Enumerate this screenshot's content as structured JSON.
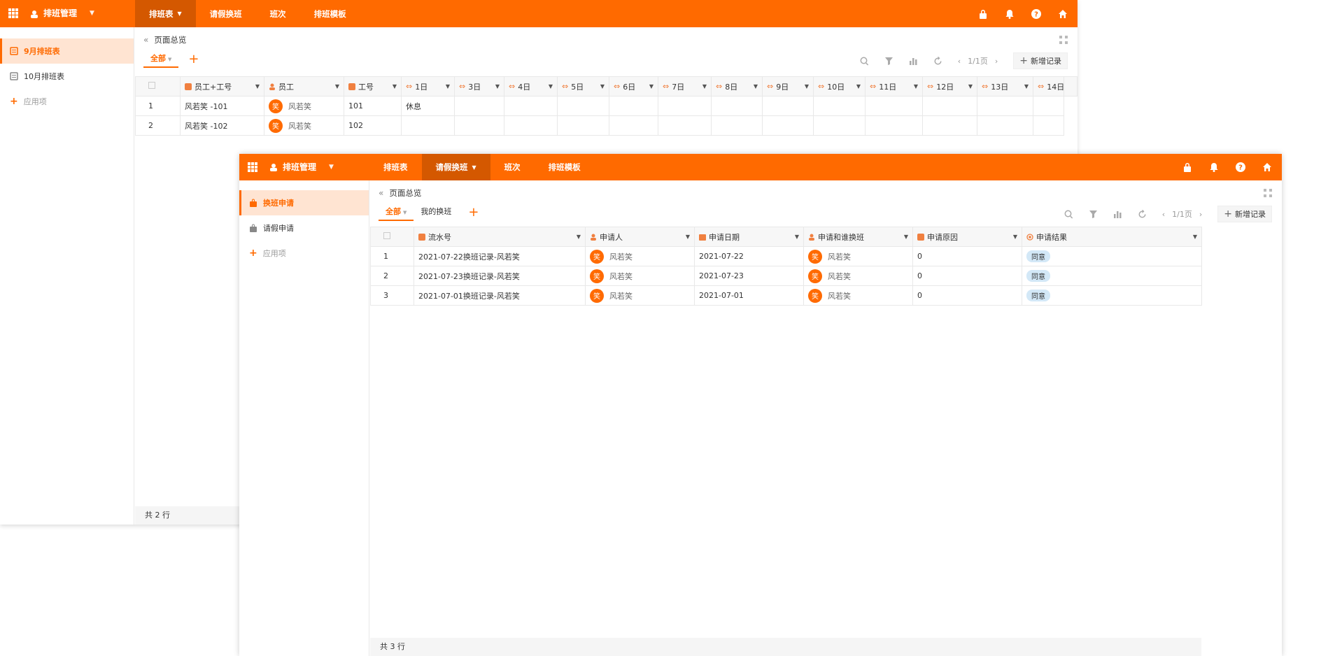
{
  "win1": {
    "app_title": "排班管理",
    "nav": [
      {
        "label": "排班表",
        "active": true,
        "has_caret": true
      },
      {
        "label": "请假换班",
        "active": false,
        "has_caret": false
      },
      {
        "label": "班次",
        "active": false,
        "has_caret": false
      },
      {
        "label": "排班模板",
        "active": false,
        "has_caret": false
      }
    ],
    "sidebar": [
      {
        "label": "9月排班表",
        "icon": "table-icon",
        "active": true
      },
      {
        "label": "10月排班表",
        "icon": "table-icon",
        "active": false
      },
      {
        "label": "应用项",
        "icon": "plus-icon",
        "active": false
      }
    ],
    "crumb": "页面总览",
    "view_tab": "全部",
    "pager": "1/1页",
    "add_label": "新增记录",
    "columns": [
      "员工+工号",
      "员工",
      "工号",
      "1日",
      "3日",
      "4日",
      "5日",
      "6日",
      "7日",
      "8日",
      "9日",
      "10日",
      "11日",
      "12日",
      "13日",
      "14日"
    ],
    "rows": [
      {
        "idx": "1",
        "emp_no": "风若笑 -101",
        "avatar": "笑",
        "name": "风若笑",
        "no": "101",
        "d1": "休息"
      },
      {
        "idx": "2",
        "emp_no": "风若笑 -102",
        "avatar": "笑",
        "name": "风若笑",
        "no": "102",
        "d1": ""
      }
    ],
    "footer": "共 2 行"
  },
  "win2": {
    "app_title": "排班管理",
    "nav": [
      {
        "label": "排班表",
        "active": false,
        "has_caret": false
      },
      {
        "label": "请假换班",
        "active": true,
        "has_caret": true
      },
      {
        "label": "班次",
        "active": false,
        "has_caret": false
      },
      {
        "label": "排班模板",
        "active": false,
        "has_caret": false
      }
    ],
    "sidebar": [
      {
        "label": "换班申请",
        "icon": "bag-icon",
        "active": true
      },
      {
        "label": "请假申请",
        "icon": "bag-icon",
        "active": false
      },
      {
        "label": "应用项",
        "icon": "plus-icon",
        "active": false
      }
    ],
    "crumb": "页面总览",
    "view_tabs": [
      "全部",
      "我的换班"
    ],
    "pager": "1/1页",
    "add_label": "新增记录",
    "columns": [
      "流水号",
      "申请人",
      "申请日期",
      "申请和谁换班",
      "申请原因",
      "申请结果"
    ],
    "rows": [
      {
        "idx": "1",
        "serial": "2021-07-22换班记录-风若笑",
        "avatar": "笑",
        "applicant": "风若笑",
        "date": "2021-07-22",
        "with": "风若笑",
        "reason": "0",
        "result": "同意"
      },
      {
        "idx": "2",
        "serial": "2021-07-23换班记录-风若笑",
        "avatar": "笑",
        "applicant": "风若笑",
        "date": "2021-07-23",
        "with": "风若笑",
        "reason": "0",
        "result": "同意"
      },
      {
        "idx": "3",
        "serial": "2021-07-01换班记录-风若笑",
        "avatar": "笑",
        "applicant": "风若笑",
        "date": "2021-07-01",
        "with": "风若笑",
        "reason": "0",
        "result": "同意"
      }
    ],
    "footer": "共 3 行"
  },
  "colors": {
    "accent": "#ff6a00",
    "accent_dark": "#d45800",
    "active_bg": "#ffe4d2",
    "badge": "#d3e8f7"
  }
}
